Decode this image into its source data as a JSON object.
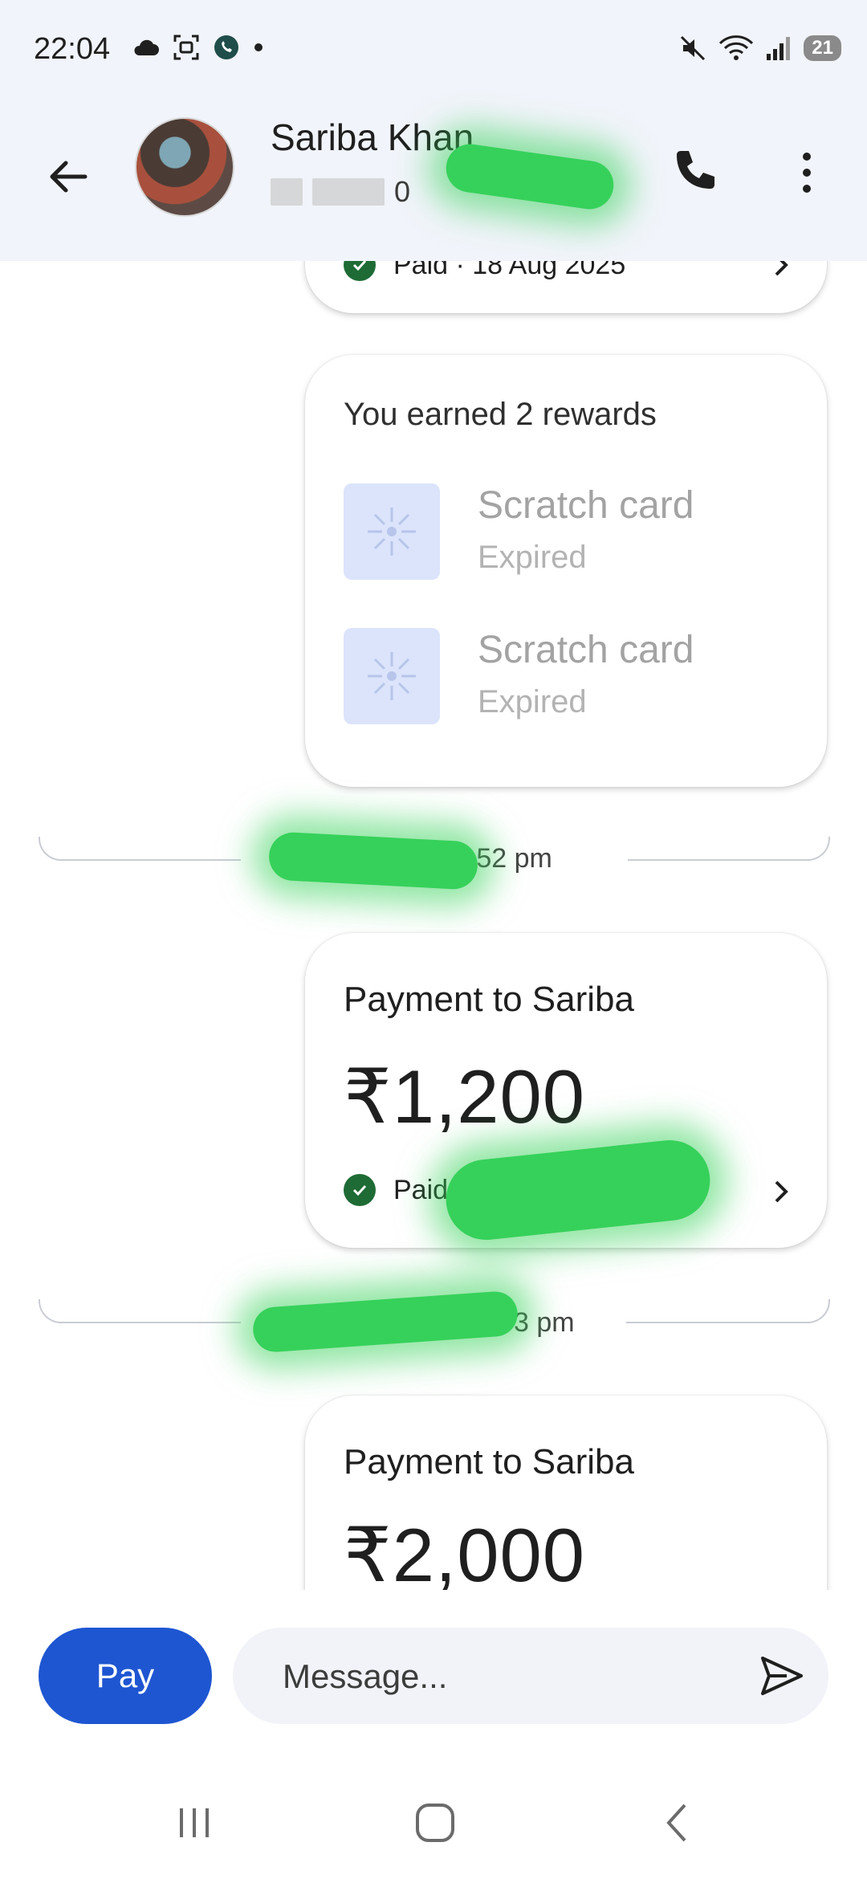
{
  "status_bar": {
    "time": "22:04",
    "left_icons": [
      "cloud-icon",
      "screenshot-icon",
      "whatsapp-icon",
      "dot-icon"
    ],
    "right_icons": [
      "mute-icon",
      "wifi-icon",
      "signal-icon"
    ],
    "battery": "21"
  },
  "header": {
    "contact_name": "Sariba Khan",
    "contact_number_visible": "0",
    "icons": [
      "back-arrow-icon",
      "phone-icon",
      "more-vert-icon"
    ]
  },
  "top_card": {
    "status_text": "Paid · 18 Aug 2025"
  },
  "rewards_card": {
    "title": "You earned 2 rewards",
    "items": [
      {
        "title": "Scratch card",
        "status": "Expired"
      },
      {
        "title": "Scratch card",
        "status": "Expired"
      }
    ]
  },
  "dividers": [
    {
      "time_visible": "6:52 pm"
    },
    {
      "time_visible": "3 pm"
    }
  ],
  "payments": [
    {
      "title": "Payment to Sariba",
      "amount": "₹1,200",
      "status": "Paid"
    },
    {
      "title": "Payment to Sariba",
      "amount": "₹2,000"
    }
  ],
  "composer": {
    "pay_label": "Pay",
    "message_placeholder": "Message..."
  },
  "nav_bar": {
    "icons": [
      "recents-icon",
      "home-icon",
      "back-icon"
    ]
  },
  "colors": {
    "accent": "#1e56d2",
    "header_bg": "#f1f4fa",
    "paid_green": "#1e6b35",
    "redaction": "#36d15a"
  }
}
